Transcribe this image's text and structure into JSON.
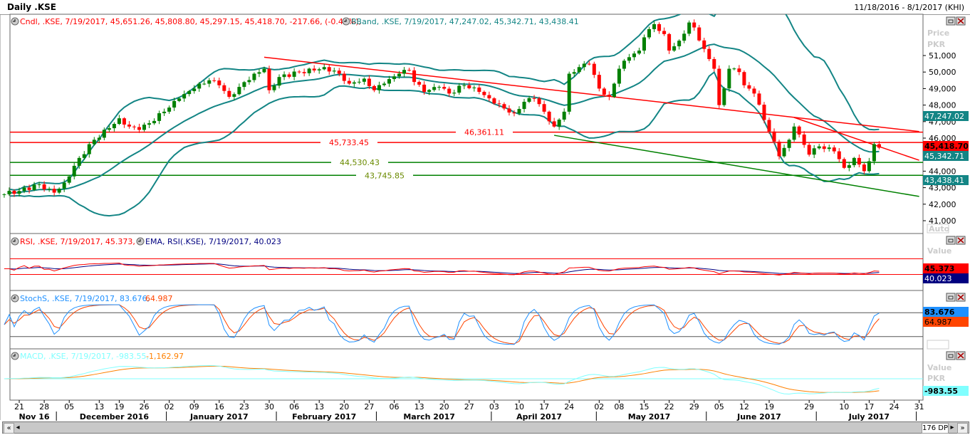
{
  "header": {
    "title": "Daily .KSE",
    "date_range": "11/18/2016 - 8/1/2017 (KHI)"
  },
  "legends": {
    "price": {
      "cndl": "Cndl, .KSE, 7/19/2017, 45,651.26, 45,808.80, 45,297.15, 45,418.70, -217.66, (-0.48%),",
      "bband": "BBand, .KSE, 7/19/2017, 47,247.02, 45,342.71, 43,438.41"
    },
    "rsi": {
      "rsi": "RSI, .KSE, 7/19/2017, 45.373,",
      "ema": "EMA, RSI(.KSE), 7/19/2017, 40.023"
    },
    "stoch": {
      "k": "StochS, .KSE, 7/19/2017, 83.676,",
      "d": "64.987"
    },
    "macd": {
      "macd": "MACD, .KSE, 7/19/2017, -983.55,",
      "signal": "-1,162.97"
    }
  },
  "axis": {
    "price_title": "Price",
    "currency": "PKR",
    "value_title": "Value",
    "auto": "Auto",
    "price_ticks": [
      "41,000",
      "42,000",
      "43,000",
      "44,000",
      "45,000",
      "46,000",
      "47,000",
      "48,000",
      "49,000",
      "50,000",
      "51,000"
    ],
    "tags": {
      "bb_upper": "47,247.02",
      "close": "45,418.70",
      "bb_mid": "45,342.71",
      "bb_lower": "43,438.41",
      "rsi": "45.373",
      "rsi_ema": "40.023",
      "stoch_k": "83.676",
      "stoch_d": "64.987",
      "macd": "-983.55"
    }
  },
  "colors": {
    "up": "#008000",
    "down": "#ff0000",
    "bband": "#138585",
    "rsi": "#ff0000",
    "rsi_ema": "#000080",
    "stoch_k": "#1e90ff",
    "stoch_d": "#ff4500",
    "macd": "#80ffff",
    "signal": "#ff8000",
    "hline_red": "#ff0000",
    "hline_green": "#008000"
  },
  "scrollbar": {
    "points": "176 DP"
  },
  "chart_data": {
    "type": "candlestick",
    "ylim": [
      40500,
      53200
    ],
    "closes": [
      [
        "2016-11-16",
        42600
      ],
      [
        "2016-11-21",
        42800
      ],
      [
        "2016-11-25",
        43200
      ],
      [
        "2016-11-28",
        42900
      ],
      [
        "2016-11-30",
        42700
      ],
      [
        "2016-12-02",
        43300
      ],
      [
        "2016-12-07",
        44800
      ],
      [
        "2016-12-12",
        45900
      ],
      [
        "2016-12-15",
        46600
      ],
      [
        "2016-12-19",
        47200
      ],
      [
        "2016-12-21",
        46700
      ],
      [
        "2016-12-23",
        46500
      ],
      [
        "2016-12-27",
        46900
      ],
      [
        "2016-12-30",
        47600
      ],
      [
        "2017-01-04",
        48400
      ],
      [
        "2017-01-09",
        49000
      ],
      [
        "2017-01-12",
        49500
      ],
      [
        "2017-01-16",
        49200
      ],
      [
        "2017-01-18",
        48500
      ],
      [
        "2017-01-20",
        49100
      ],
      [
        "2017-01-25",
        49900
      ],
      [
        "2017-01-27",
        50200
      ],
      [
        "2017-01-30",
        48900
      ],
      [
        "2017-02-01",
        49700
      ],
      [
        "2017-02-07",
        50000
      ],
      [
        "2017-02-10",
        50100
      ],
      [
        "2017-02-14",
        50300
      ],
      [
        "2017-02-17",
        49900
      ],
      [
        "2017-02-21",
        49300
      ],
      [
        "2017-02-24",
        49600
      ],
      [
        "2017-02-28",
        48900
      ],
      [
        "2017-03-02",
        49300
      ],
      [
        "2017-03-07",
        49900
      ],
      [
        "2017-03-09",
        50100
      ],
      [
        "2017-03-10",
        49400
      ],
      [
        "2017-03-14",
        48800
      ],
      [
        "2017-03-17",
        49100
      ],
      [
        "2017-03-21",
        48700
      ],
      [
        "2017-03-24",
        49200
      ],
      [
        "2017-03-29",
        48800
      ],
      [
        "2017-04-03",
        48100
      ],
      [
        "2017-04-07",
        47500
      ],
      [
        "2017-04-11",
        48200
      ],
      [
        "2017-04-13",
        48400
      ],
      [
        "2017-04-17",
        47600
      ],
      [
        "2017-04-19",
        46700
      ],
      [
        "2017-04-21",
        47600
      ],
      [
        "2017-04-24",
        49900
      ],
      [
        "2017-04-26",
        50300
      ],
      [
        "2017-04-28",
        50500
      ],
      [
        "2017-05-02",
        49000
      ],
      [
        "2017-05-04",
        48500
      ],
      [
        "2017-05-08",
        50200
      ],
      [
        "2017-05-10",
        50900
      ],
      [
        "2017-05-12",
        51300
      ],
      [
        "2017-05-15",
        52100
      ],
      [
        "2017-05-17",
        52900
      ],
      [
        "2017-05-19",
        52300
      ],
      [
        "2017-05-22",
        51300
      ],
      [
        "2017-05-24",
        51900
      ],
      [
        "2017-05-26",
        53000
      ],
      [
        "2017-05-29",
        52700
      ],
      [
        "2017-05-31",
        51400
      ],
      [
        "2017-06-02",
        50200
      ],
      [
        "2017-06-05",
        48000
      ],
      [
        "2017-06-07",
        50200
      ],
      [
        "2017-06-09",
        50000
      ],
      [
        "2017-06-12",
        49200
      ],
      [
        "2017-06-14",
        48700
      ],
      [
        "2017-06-16",
        47100
      ],
      [
        "2017-06-19",
        46400
      ],
      [
        "2017-06-21",
        44900
      ],
      [
        "2017-06-23",
        45900
      ],
      [
        "2017-06-26",
        46700
      ],
      [
        "2017-06-29",
        45000
      ],
      [
        "2017-07-03",
        45500
      ],
      [
        "2017-07-06",
        45200
      ],
      [
        "2017-07-10",
        44200
      ],
      [
        "2017-07-12",
        44800
      ],
      [
        "2017-07-14",
        44000
      ],
      [
        "2017-07-17",
        44600
      ],
      [
        "2017-07-18",
        45636
      ],
      [
        "2017-07-19",
        45418.7
      ]
    ],
    "horizontal_lines": [
      {
        "value": 46361.11,
        "label": "46,361.11",
        "color": "red"
      },
      {
        "value": 45733.45,
        "label": "45,733.45",
        "color": "red"
      },
      {
        "value": 44530.43,
        "label": "44,530.43",
        "color": "green"
      },
      {
        "value": 43745.85,
        "label": "43,745.85",
        "color": "green"
      }
    ],
    "trend_lines": [
      {
        "from": [
          "2017-01-27",
          50900
        ],
        "to": [
          "2017-07-31",
          46400
        ],
        "color": "red"
      },
      {
        "from": [
          "2017-06-26",
          47250
        ],
        "to": [
          "2017-07-31",
          44660
        ],
        "color": "red"
      },
      {
        "from": [
          "2017-04-19",
          46170
        ],
        "to": [
          "2017-07-31",
          42470
        ],
        "color": "green"
      }
    ],
    "rsi_levels": [
      70,
      30
    ],
    "stoch_levels": [
      80,
      20
    ],
    "x_ticks": [
      [
        "2016-11-21",
        "21"
      ],
      [
        "2016-11-28",
        "28"
      ],
      [
        "2016-12-05",
        "05"
      ],
      [
        "2016-12-13",
        "13"
      ],
      [
        "2016-12-19",
        "19"
      ],
      [
        "2016-12-26",
        "26"
      ],
      [
        "2017-01-02",
        "02"
      ],
      [
        "2017-01-09",
        "09"
      ],
      [
        "2017-01-16",
        "16"
      ],
      [
        "2017-01-23",
        "23"
      ],
      [
        "2017-01-30",
        "30"
      ],
      [
        "2017-02-06",
        "06"
      ],
      [
        "2017-02-13",
        "13"
      ],
      [
        "2017-02-20",
        "20"
      ],
      [
        "2017-02-27",
        "27"
      ],
      [
        "2017-03-06",
        "06"
      ],
      [
        "2017-03-13",
        "13"
      ],
      [
        "2017-03-20",
        "20"
      ],
      [
        "2017-03-27",
        "27"
      ],
      [
        "2017-04-03",
        "03"
      ],
      [
        "2017-04-10",
        "10"
      ],
      [
        "2017-04-17",
        "17"
      ],
      [
        "2017-04-24",
        "24"
      ],
      [
        "2017-05-02",
        "02"
      ],
      [
        "2017-05-08",
        "08"
      ],
      [
        "2017-05-15",
        "15"
      ],
      [
        "2017-05-22",
        "22"
      ],
      [
        "2017-05-29",
        "29"
      ],
      [
        "2017-06-05",
        "05"
      ],
      [
        "2017-06-12",
        "12"
      ],
      [
        "2017-06-19",
        "19"
      ],
      [
        "2017-06-29",
        "29"
      ],
      [
        "2017-07-10",
        "10"
      ],
      [
        "2017-07-17",
        "17"
      ],
      [
        "2017-07-24",
        "24"
      ],
      [
        "2017-07-31",
        "31"
      ]
    ],
    "months": [
      [
        "2016-11-24",
        "Nov 16"
      ],
      [
        "2016-12-16",
        "December 2016"
      ],
      [
        "2017-01-16",
        "January 2017"
      ],
      [
        "2017-02-14",
        "February 2017"
      ],
      [
        "2017-03-15",
        "March 2017"
      ],
      [
        "2017-04-14",
        "April 2017"
      ],
      [
        "2017-05-16",
        "May 2017"
      ],
      [
        "2017-06-15",
        "June 2017"
      ],
      [
        "2017-07-17",
        "July 2017"
      ]
    ]
  }
}
